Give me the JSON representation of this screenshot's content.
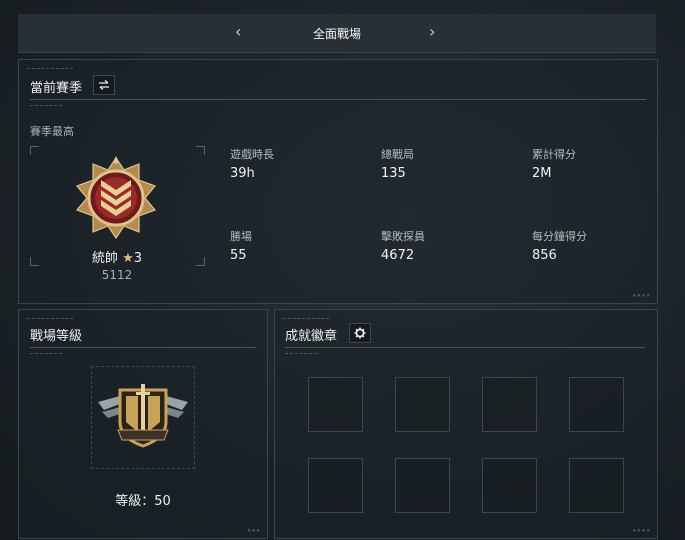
{
  "nav": {
    "title": "全面戰場",
    "prev_icon": "chevron-left-icon",
    "next_icon": "chevron-right-icon"
  },
  "season": {
    "title": "當前賽季",
    "swap_icon": "swap-icon",
    "best_label": "賽季最高",
    "rank_name": "統帥",
    "rank_stars": "3",
    "rank_points": "5112",
    "stats": [
      {
        "label": "遊戲時長",
        "value": "39h"
      },
      {
        "label": "總戰局",
        "value": "135"
      },
      {
        "label": "累計得分",
        "value": "2M"
      },
      {
        "label": "勝場",
        "value": "55"
      },
      {
        "label": "擊敗探員",
        "value": "4672"
      },
      {
        "label": "每分鐘得分",
        "value": "856"
      }
    ]
  },
  "battle_level": {
    "title": "戰場等級",
    "level_text": "等級：50"
  },
  "badges": {
    "title": "成就徽章",
    "settings_icon": "gear-icon",
    "slots": 8
  },
  "colors": {
    "gold": "#c9a25a",
    "red": "#8c1f22",
    "panel_border": "#3a454b"
  }
}
